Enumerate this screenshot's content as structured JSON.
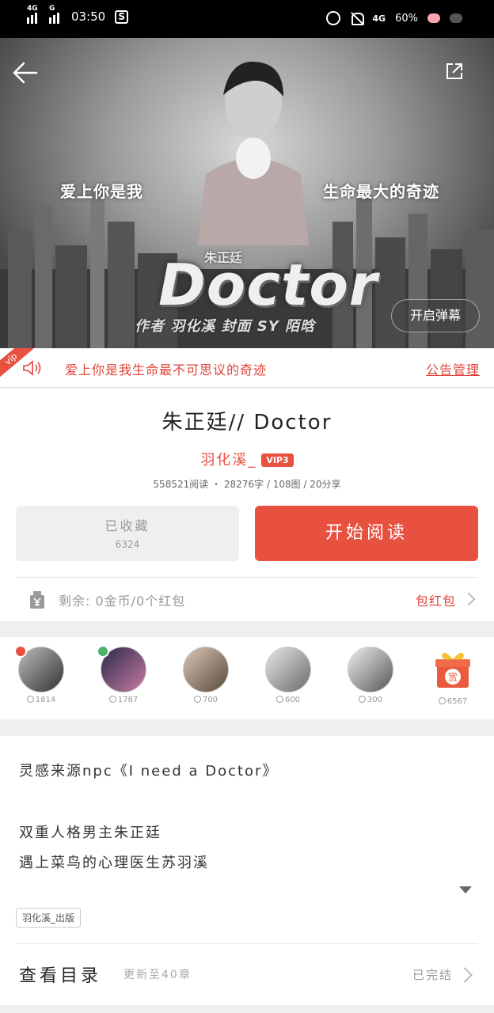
{
  "status_bar": {
    "signal_1": "4G",
    "signal_2": "G",
    "time": "03:50",
    "network": "4G",
    "battery": "60%"
  },
  "hero": {
    "quote_left": "爱上你是我",
    "quote_right": "生命最大的奇迹",
    "subtitle": "朱正廷",
    "cover_title": "Doctor",
    "credit": "作者 羽化溪 封面 SY 陌晗",
    "danmaku_label": "开启弹幕"
  },
  "notice": {
    "ribbon": "vip",
    "text": "爱上你是我生命最不可思议的奇迹",
    "link": "公告管理"
  },
  "book": {
    "title": "朱正廷// Doctor",
    "author": "羽化溪_",
    "vip_level": "VIP3",
    "stats": "558521阅读 ・ 28276字 / 108图 / 20分享",
    "collect_label": "已收藏",
    "collect_count": "6324",
    "read_label": "开始阅读",
    "coins_text": "剩余: 0金币/0个红包",
    "hongbao_label": "包红包"
  },
  "fans": [
    {
      "amount": "1814",
      "badge": "#e8503f"
    },
    {
      "amount": "1787",
      "badge": "#4cb36b"
    },
    {
      "amount": "700",
      "badge": ""
    },
    {
      "amount": "600",
      "badge": ""
    },
    {
      "amount": "300",
      "badge": ""
    },
    {
      "amount": "6567",
      "gift_label": "赏"
    }
  ],
  "description": {
    "line1": "灵感来源npc《I need a Doctor》",
    "line2": "双重人格男主朱正廷",
    "line3": "遇上菜鸟的心理医生苏羽溪",
    "tag": "羽化溪_出版"
  },
  "catalog": {
    "title": "查看目录",
    "update": "更新至40章",
    "status": "已完结"
  },
  "colors": {
    "accent": "#e8503f",
    "notice_red": "#e0443a"
  }
}
